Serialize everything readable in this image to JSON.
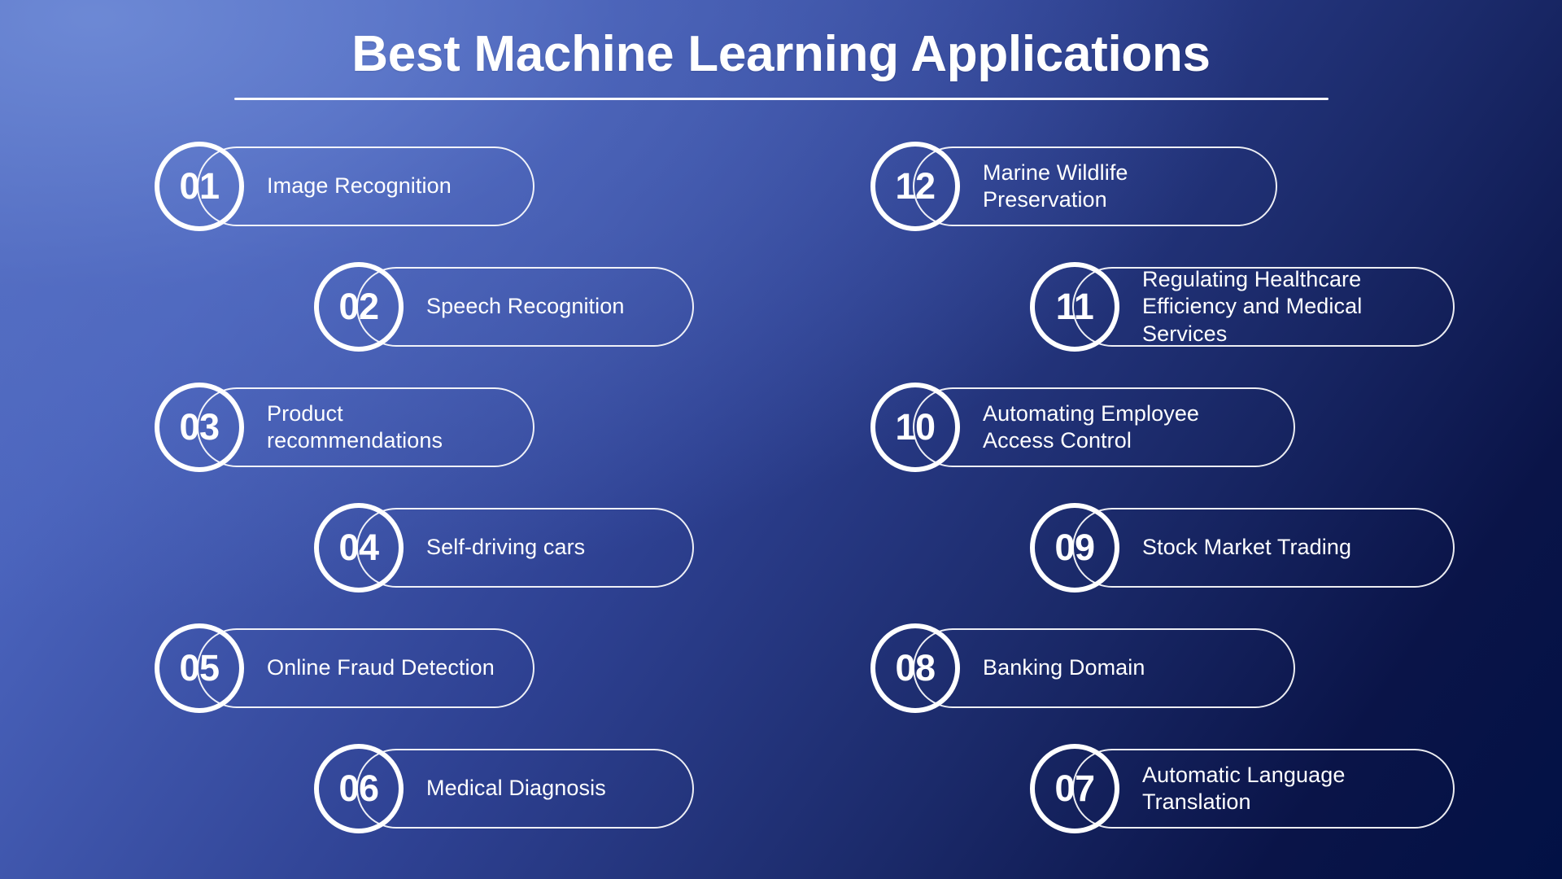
{
  "header": {
    "title": "Best Machine Learning Applications"
  },
  "colors": {
    "background_top_left": "#5670C4",
    "background_top_right": "#1A2A68",
    "background_bottom_right": "#021145",
    "accent": "#FFFFFF",
    "text": "#FFFFFF"
  },
  "left_column": [
    {
      "number": "01",
      "label": "Image Recognition",
      "indent": false,
      "width": "w-short"
    },
    {
      "number": "02",
      "label": "Speech Recognition",
      "indent": true,
      "width": "w-short"
    },
    {
      "number": "03",
      "label": "Product\nrecommendations",
      "indent": false,
      "width": "w-short"
    },
    {
      "number": "04",
      "label": "Self-driving cars",
      "indent": true,
      "width": "w-short"
    },
    {
      "number": "05",
      "label": "Online Fraud Detection",
      "indent": false,
      "width": "w-short"
    },
    {
      "number": "06",
      "label": "Medical Diagnosis",
      "indent": true,
      "width": "w-short"
    }
  ],
  "right_column": [
    {
      "number": "12",
      "label": "Marine Wildlife\nPreservation",
      "indent": false,
      "width": "w-mid"
    },
    {
      "number": "11",
      "label": "Regulating Healthcare\nEfficiency and Medical\nServices",
      "indent": true,
      "width": "w-long"
    },
    {
      "number": "10",
      "label": "Automating Employee\nAccess Control",
      "indent": false,
      "width": "w-long"
    },
    {
      "number": "09",
      "label": "Stock Market Trading",
      "indent": true,
      "width": "w-long"
    },
    {
      "number": "08",
      "label": "Banking Domain",
      "indent": false,
      "width": "w-long"
    },
    {
      "number": "07",
      "label": "Automatic Language\nTranslation",
      "indent": true,
      "width": "w-long"
    }
  ]
}
